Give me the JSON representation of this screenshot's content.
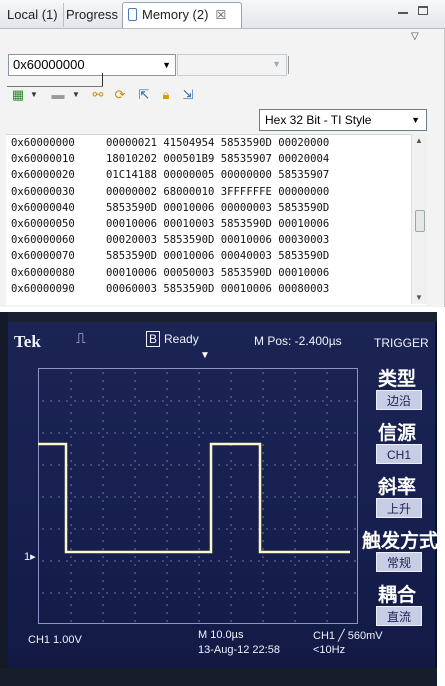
{
  "tabs": {
    "local": "Local (1)",
    "progress": "Progress",
    "memory": "Memory (2)",
    "close": "☒"
  },
  "address_combo": {
    "value": "0x60000000"
  },
  "format_select": {
    "value": "Hex 32 Bit - TI Style"
  },
  "memory": {
    "rows": [
      {
        "addr": "0x60000000",
        "data": "00000021 41504954 5853590D 00020000"
      },
      {
        "addr": "0x60000010",
        "data": "18010202 000501B9 58535907 00020004"
      },
      {
        "addr": "0x60000020",
        "data": "01C14188 00000005 00000000 58535907"
      },
      {
        "addr": "0x60000030",
        "data": "00000002 68000010 3FFFFFFE 00000000"
      },
      {
        "addr": "0x60000040",
        "data": "5853590D 00010006 00000003 5853590D"
      },
      {
        "addr": "0x60000050",
        "data": "00010006 00010003 5853590D 00010006"
      },
      {
        "addr": "0x60000060",
        "data": "00020003 5853590D 00010006 00030003"
      },
      {
        "addr": "0x60000070",
        "data": "5853590D 00010006 00040003 5853590D"
      },
      {
        "addr": "0x60000080",
        "data": "00010006 00050003 5853590D 00010006"
      },
      {
        "addr": "0x60000090",
        "data": "00060003 5853590D 00010006 00080003"
      }
    ]
  },
  "scope": {
    "brand": "Tek",
    "state": "Ready",
    "state_box": "B",
    "mpos": "M Pos: -2.400µs",
    "trigger": "TRIGGER",
    "ch1_scale": "CH1  1.00V",
    "timebase": "M 10.0µs",
    "date": "13-Aug-12 22:58",
    "trig_level": "CH1 ╱ 560mV",
    "freq": "<10Hz",
    "ch1_marker": "1▸",
    "panel": [
      {
        "title": "类型",
        "button": "边沿"
      },
      {
        "title": "信源",
        "button": "CH1"
      },
      {
        "title": "斜率",
        "button": "上升"
      },
      {
        "title": "触发方式",
        "button": "常规"
      },
      {
        "title": "耦合",
        "button": "直流"
      }
    ],
    "colors": {
      "trace": "#fbf7c8",
      "screen": "#1a2352"
    }
  }
}
